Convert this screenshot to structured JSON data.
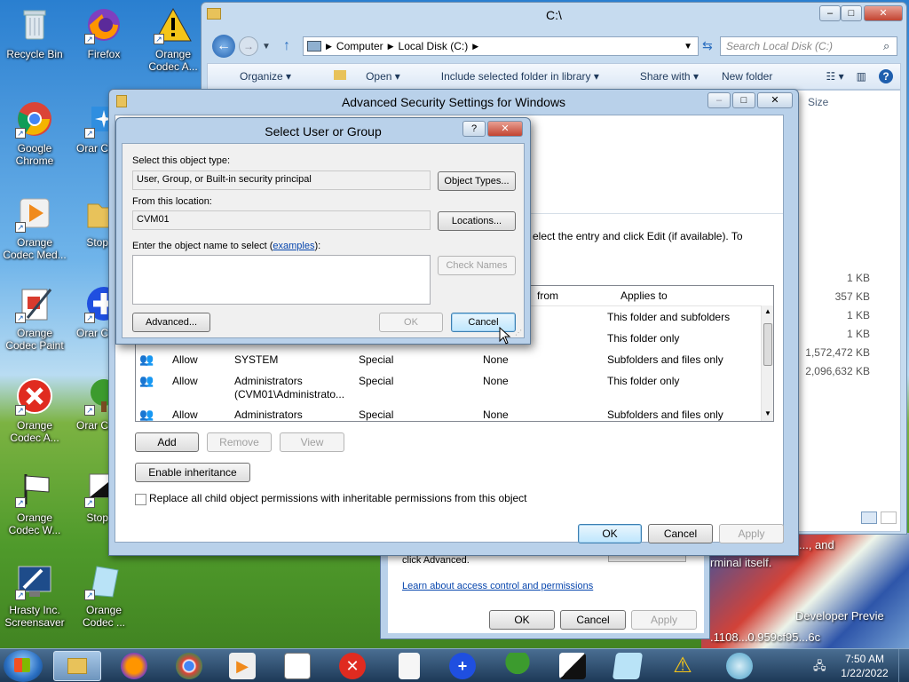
{
  "desktop": {
    "icons": [
      {
        "label": "Recycle Bin"
      },
      {
        "label": "Firefox"
      },
      {
        "label": "Orange Codec A..."
      },
      {
        "label": "Google Chrome"
      },
      {
        "label": "Orar Codec"
      },
      {
        "label": "Orange Codec Med..."
      },
      {
        "label": "Stop W"
      },
      {
        "label": "Orange Codec Paint"
      },
      {
        "label": "Orar Codec"
      },
      {
        "label": "Orange Codec A..."
      },
      {
        "label": "Orar Codec"
      },
      {
        "label": "Orange Codec W..."
      },
      {
        "label": "Stop W"
      },
      {
        "label": "Hrasty Inc. Screensaver"
      },
      {
        "label": "Orange Codec ..."
      }
    ],
    "wallpaper_text": {
      "line1": "..., and",
      "line2": "rminal itself.",
      "line3": "Developer Previe",
      "line4": ".1108...0.959cf95...6c"
    }
  },
  "explorer": {
    "title": "C:\\",
    "breadcrumb": [
      "Computer",
      "Local Disk (C:)"
    ],
    "search_placeholder": "Search Local Disk (C:)",
    "toolbar": [
      "Organize",
      "Open",
      "Include selected folder in library",
      "Share with",
      "New folder"
    ],
    "column_size": "Size",
    "sizes": [
      "1 KB",
      "357 KB",
      "1 KB",
      "1 KB",
      "1,572,472 KB",
      "2,096,632 KB"
    ]
  },
  "permissions_dialog": {
    "note": "click Advanced.",
    "link": "Learn about access control and permissions",
    "ok": "OK",
    "cancel": "Cancel",
    "apply": "Apply"
  },
  "advanced": {
    "title": "Advanced Security Settings for Windows",
    "hint": "elect the entry and click Edit (if available). To",
    "columns": {
      "from": "from",
      "applies": "Applies to"
    },
    "rows": [
      {
        "type": "",
        "principal": "",
        "access": "",
        "inherited": "",
        "applies": "This folder and subfolders"
      },
      {
        "type": "",
        "principal": "",
        "access": "",
        "inherited": "",
        "applies": "This folder only"
      },
      {
        "type": "Allow",
        "principal": "SYSTEM",
        "access": "Special",
        "inherited": "None",
        "applies": "Subfolders and files only"
      },
      {
        "type": "Allow",
        "principal": "Administrators (CVM01\\Administrato...",
        "access": "Special",
        "inherited": "None",
        "applies": "This folder only"
      },
      {
        "type": "Allow",
        "principal": "Administrators",
        "access": "Special",
        "inherited": "None",
        "applies": "Subfolders and files only"
      }
    ],
    "add": "Add",
    "remove": "Remove",
    "view": "View",
    "enable_inheritance": "Enable inheritance",
    "replace_label": "Replace all child object permissions with inheritable permissions from this object",
    "ok": "OK",
    "cancel": "Cancel",
    "apply": "Apply"
  },
  "select_user": {
    "title": "Select User or Group",
    "help": "?",
    "object_type_label": "Select this object type:",
    "object_type_value": "User, Group, or Built-in security principal",
    "object_types_btn": "Object Types...",
    "location_label": "From this location:",
    "location_value": "CVM01",
    "locations_btn": "Locations...",
    "enter_label_prefix": "Enter the object name to select (",
    "enter_label_link": "examples",
    "enter_label_suffix": "):",
    "object_name_value": "",
    "check_names_btn": "Check Names",
    "advanced_btn": "Advanced...",
    "ok": "OK",
    "cancel": "Cancel"
  },
  "taskbar": {
    "time": "7:50 AM",
    "date": "1/22/2022"
  }
}
